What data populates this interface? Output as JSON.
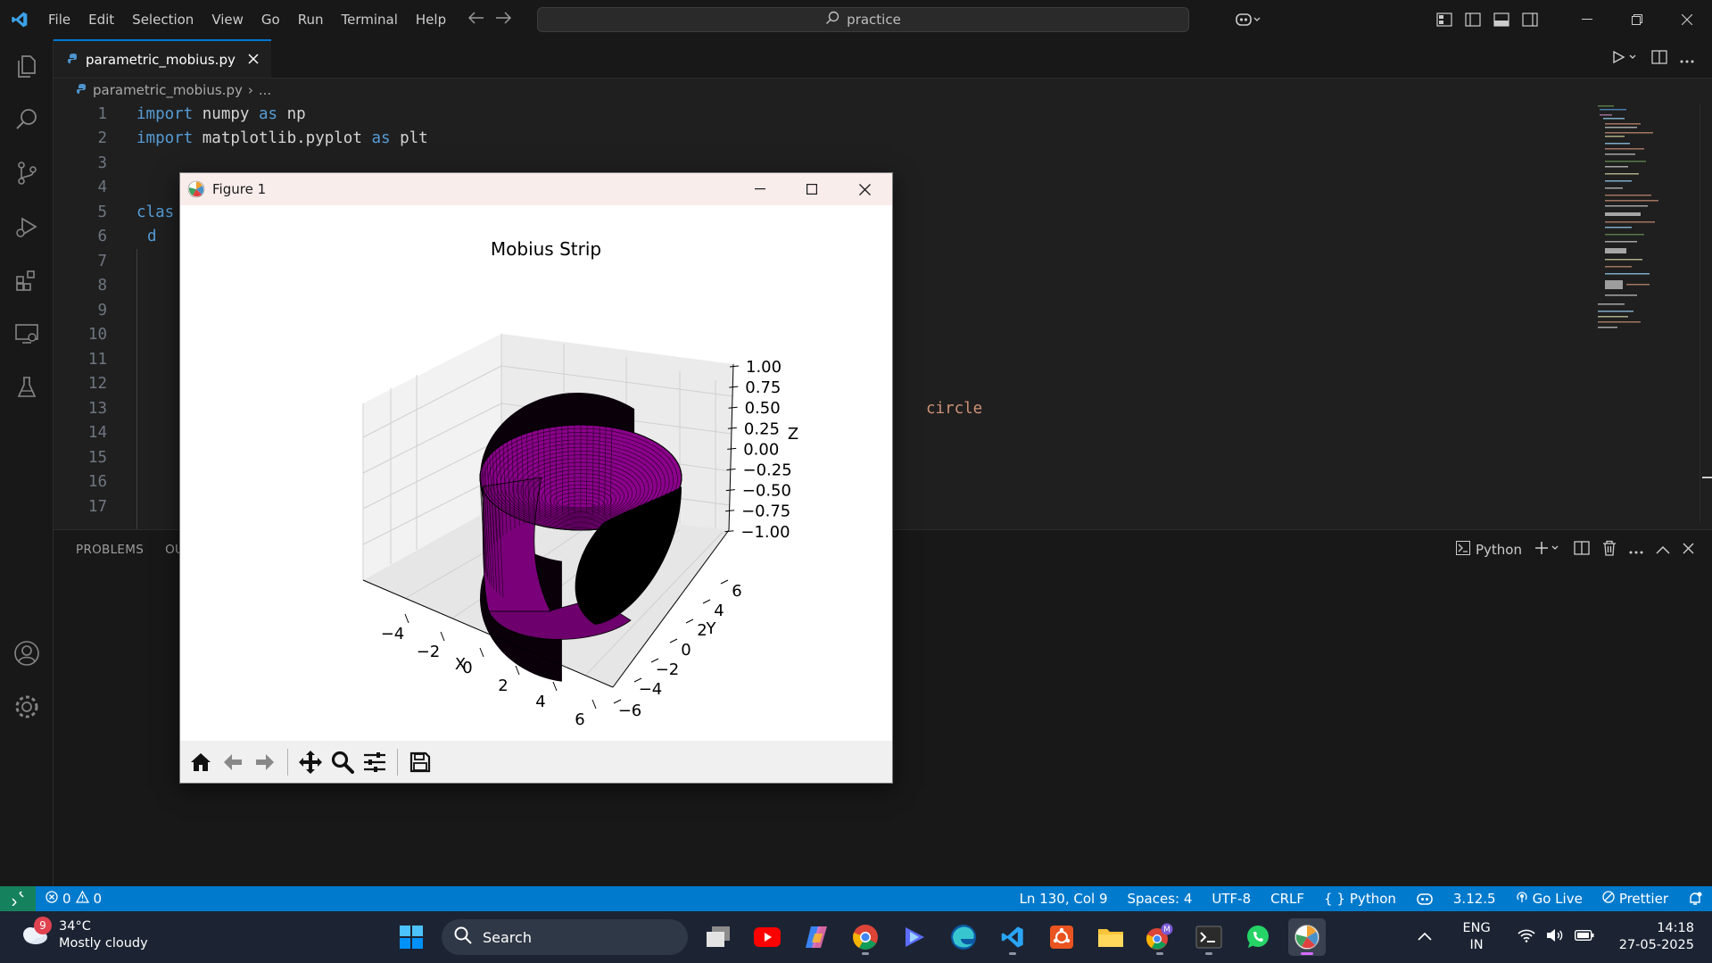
{
  "titlebar": {
    "menu": [
      "File",
      "Edit",
      "Selection",
      "View",
      "Go",
      "Run",
      "Terminal",
      "Help"
    ],
    "search_text": "practice"
  },
  "editor": {
    "tab_label": "parametric_mobius.py",
    "breadcrumb_file": "parametric_mobius.py",
    "breadcrumb_rest": "...",
    "lines": [
      {
        "n": "1",
        "html_kind": "import1"
      },
      {
        "n": "2",
        "html_kind": "import2"
      },
      {
        "n": "3"
      },
      {
        "n": "4"
      },
      {
        "n": "5"
      },
      {
        "n": "6"
      },
      {
        "n": "7"
      },
      {
        "n": "8"
      },
      {
        "n": "9"
      },
      {
        "n": "10"
      },
      {
        "n": "11"
      },
      {
        "n": "12"
      },
      {
        "n": "13"
      },
      {
        "n": "14"
      },
      {
        "n": "15"
      },
      {
        "n": "16"
      },
      {
        "n": "17"
      }
    ],
    "code": {
      "import_kw": "import",
      "as_kw": "as",
      "mod1": "numpy",
      "alias1": "np",
      "mod2": "matplotlib.pyplot",
      "alias2": "plt",
      "class_fragment": "clas",
      "line6_fragment": "d",
      "line13_tail": "circle"
    }
  },
  "panel": {
    "tab_problems": "PROBLEMS",
    "tab_output_fragment": "OU",
    "terminal_profile": "Python"
  },
  "figure": {
    "window_title": "Figure 1",
    "chart_data": {
      "type": "surface3d",
      "title": "Mobius Strip",
      "xlabel": "X",
      "ylabel": "Y",
      "zlabel": "Z",
      "x_ticks": [
        "−4",
        "−2",
        "0",
        "2",
        "4",
        "6"
      ],
      "y_ticks": [
        "−6",
        "−4",
        "−2",
        "0",
        "2",
        "4",
        "6"
      ],
      "z_ticks": [
        "1.00",
        "0.75",
        "0.50",
        "0.25",
        "0.00",
        "−0.25",
        "−0.50",
        "−0.75",
        "−1.00"
      ],
      "xlim": [
        -5,
        6
      ],
      "ylim": [
        -6,
        6
      ],
      "zlim": [
        -1,
        1
      ],
      "surface_color": "#8b008b",
      "edge_color": "#000000"
    }
  },
  "statusbar": {
    "errors": "0",
    "warnings": "0",
    "position": "Ln 130, Col 9",
    "spaces": "Spaces: 4",
    "encoding": "UTF-8",
    "eol": "CRLF",
    "language": "Python",
    "python_version": "3.12.5",
    "go_live": "Go Live",
    "prettier": "Prettier"
  },
  "taskbar": {
    "weather_temp": "34°C",
    "weather_desc": "Mostly cloudy",
    "weather_badge": "9",
    "search_label": "Search",
    "lang_top": "ENG",
    "lang_bottom": "IN",
    "time": "14:18",
    "date": "27-05-2025"
  },
  "colors": {
    "accent": "#007acc",
    "remote": "#16825d",
    "tab_border": "#0078d4"
  }
}
